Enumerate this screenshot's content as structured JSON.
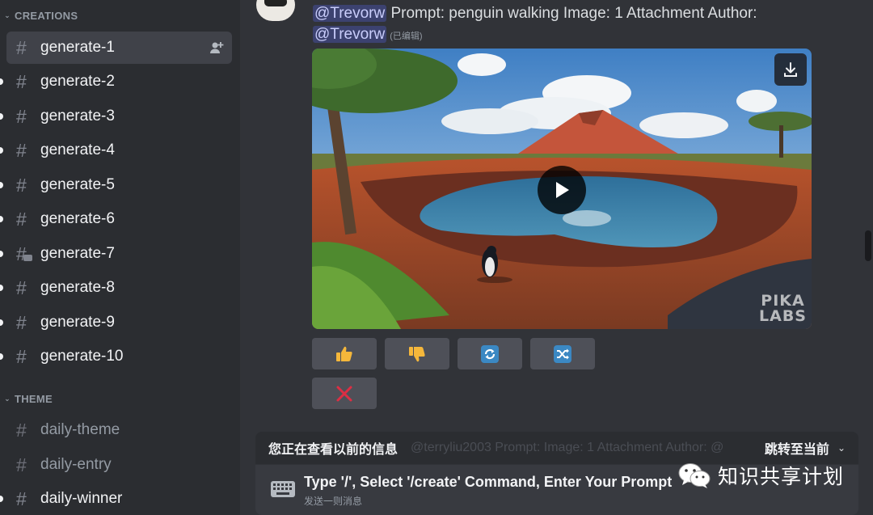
{
  "sidebar": {
    "categories": [
      {
        "label": "CREATIONS"
      },
      {
        "label": "THEME"
      }
    ],
    "channels": [
      {
        "label": "generate-1"
      },
      {
        "label": "generate-2"
      },
      {
        "label": "generate-3"
      },
      {
        "label": "generate-4"
      },
      {
        "label": "generate-5"
      },
      {
        "label": "generate-6"
      },
      {
        "label": "generate-7"
      },
      {
        "label": "generate-8"
      },
      {
        "label": "generate-9"
      },
      {
        "label": "generate-10"
      }
    ],
    "theme_channels": [
      {
        "label": "daily-theme"
      },
      {
        "label": "daily-entry"
      },
      {
        "label": "daily-winner"
      }
    ]
  },
  "message": {
    "mention_1": "@Trevorw",
    "text": "Prompt: penguin walking  Image: 1 Attachment  Author:",
    "mention_2": "@Trevorw",
    "edited": "(已编辑)",
    "watermark_line1": "PIKA",
    "watermark_line2": "LABS",
    "icons": {
      "download": "download-icon",
      "play": "play-icon",
      "thumbs_up": "thumbs-up-icon",
      "thumbs_down": "thumbs-down-icon",
      "redo": "redo-icon",
      "shuffle": "shuffle-icon",
      "delete": "x-icon"
    }
  },
  "banner": {
    "text": "您正在查看以前的信息",
    "ghost": "@terryliu2003 Prompt: Image: 1 Attachment Author: @",
    "jump": "跳转至当前"
  },
  "composer": {
    "title": "Type '/', Select '/create' Command, Enter Your Prompt",
    "subtitle": "发送一则消息"
  },
  "watermark": {
    "text": "知识共享计划"
  },
  "colors": {
    "sidebar_bg": "#2b2d31",
    "main_bg": "#313338",
    "active_channel": "#404249",
    "mention_bg": "#3c4270",
    "button_bg": "#4e5058",
    "thumb_yellow": "#f5b73b",
    "action_blue": "#3b88c3",
    "delete_red": "#dd2e44"
  }
}
